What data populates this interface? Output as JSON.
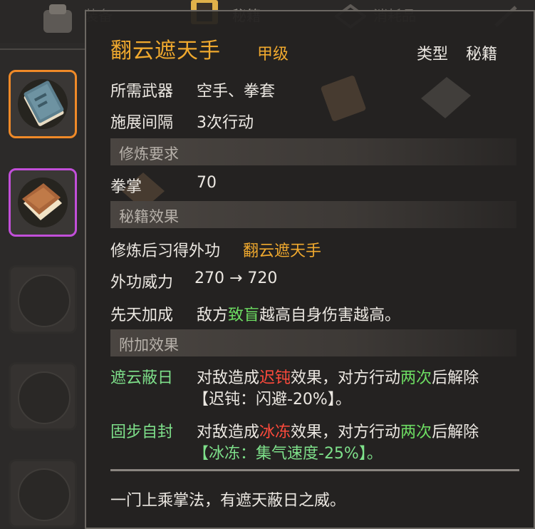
{
  "tabs": [
    "装备",
    "秘籍",
    "消耗品"
  ],
  "skill": {
    "name": "翻云遮天手",
    "grade": "甲级",
    "type_label": "类型",
    "type_value": "秘籍",
    "weapon_label": "所需武器",
    "weapon_value": "空手、拳套",
    "interval_label": "施展间隔",
    "interval_value": "3次行动"
  },
  "requirements": {
    "header": "修炼要求",
    "skill_label": "拳掌",
    "skill_value": "70"
  },
  "effects": {
    "header": "秘籍效果",
    "learn_label": "修炼后习得外功",
    "learn_value": "翻云遮天手",
    "power_label": "外功威力",
    "power_value": "270 → 720",
    "innate_label": "先天加成",
    "innate_pre": "敌方",
    "innate_key": "致盲",
    "innate_post": "越高自身伤害越高。"
  },
  "extra": {
    "header": "附加效果",
    "items": [
      {
        "name": "遮云蔽日",
        "pre": "对敌造成",
        "status": "迟钝",
        "mid": "效果，对方行动",
        "count": "两次",
        "post": "后解除",
        "detail": "【迟钝：闪避-20%】。"
      },
      {
        "name": "固步自封",
        "pre": "对敌造成",
        "status": "冰冻",
        "mid": "效果，对方行动",
        "count": "两次",
        "post": "后解除",
        "detail": "【冰冻：集气速度-25%】。"
      }
    ]
  },
  "flavor": "一门上乘掌法，有遮天蔽日之威。",
  "colors": {
    "gold": "#f0a92e",
    "green": "#6ddd62",
    "red": "#ff4a3c",
    "orange_border": "#f08a28",
    "purple_border": "#c24fd9"
  }
}
